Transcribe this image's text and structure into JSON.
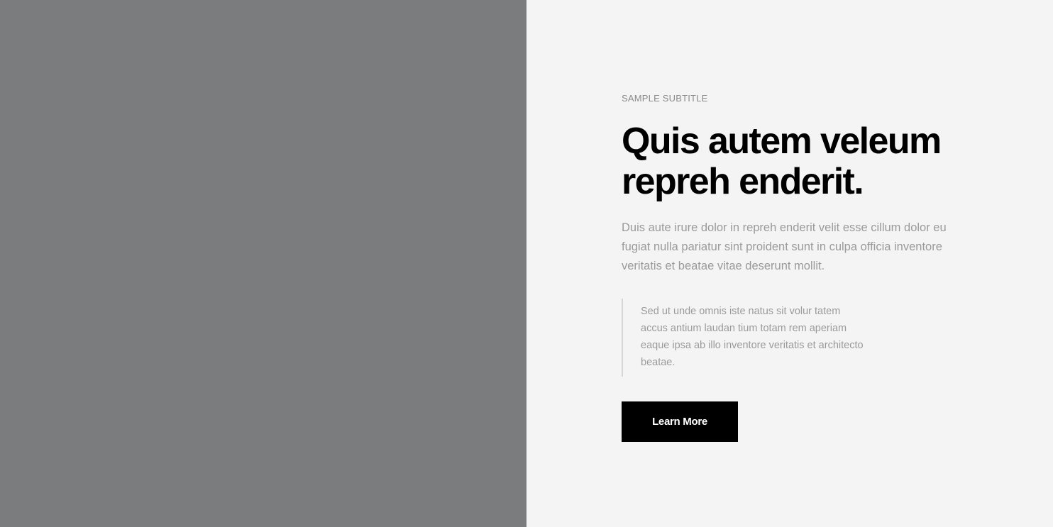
{
  "hero": {
    "subtitle": "SAMPLE SUBTITLE",
    "heading": "Quis autem veleum repreh enderit.",
    "description": "Duis aute irure dolor in repreh enderit velit esse cillum dolor eu fugiat nulla pariatur sint proident sunt in culpa officia inventore veritatis et beatae vitae deserunt mollit.",
    "quote": "Sed ut unde omnis iste natus sit volur tatem accus antium laudan tium totam rem aperiam eaque ipsa ab illo inventore veritatis et architecto beatae.",
    "button_label": "Learn More"
  },
  "colors": {
    "image_placeholder": "#7b7c7e",
    "panel_background": "#f4f4f4",
    "heading": "#000000",
    "muted_text": "#9a9a9a",
    "button_background": "#000000",
    "button_text": "#ffffff"
  }
}
